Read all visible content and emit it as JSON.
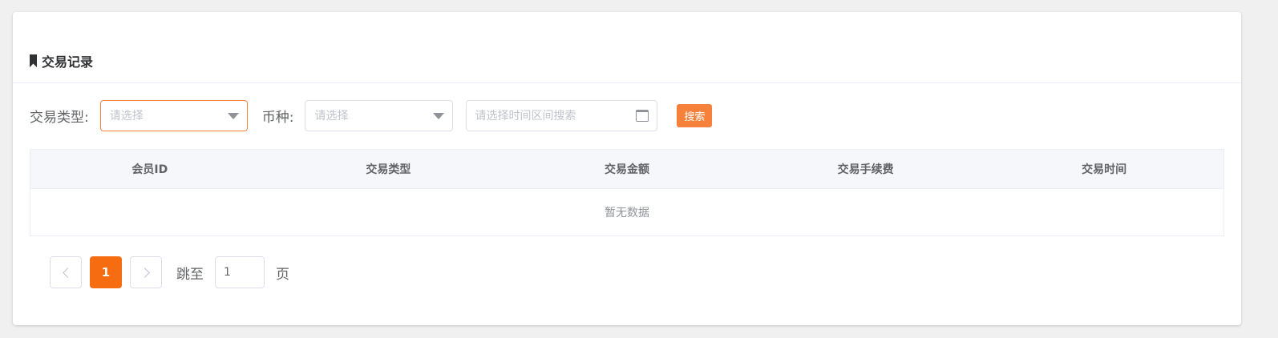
{
  "header": {
    "title": "交易记录",
    "icon": "bookmark-icon"
  },
  "filters": {
    "trade_type_label": "交易类型:",
    "trade_type_placeholder": "请选择",
    "currency_label": "币种:",
    "currency_placeholder": "请选择",
    "date_placeholder": "请选择时间区间搜索",
    "search_label": "搜索"
  },
  "table": {
    "columns": [
      "会员ID",
      "交易类型",
      "交易金额",
      "交易手续费",
      "交易时间"
    ],
    "empty_text": "暂无数据"
  },
  "pagination": {
    "current_page": "1",
    "jump_label": "跳至",
    "jump_value": "1",
    "page_unit": "页"
  },
  "colors": {
    "accent": "#f5813b",
    "page_active": "#f56c11",
    "background": "#f0f0f0"
  }
}
